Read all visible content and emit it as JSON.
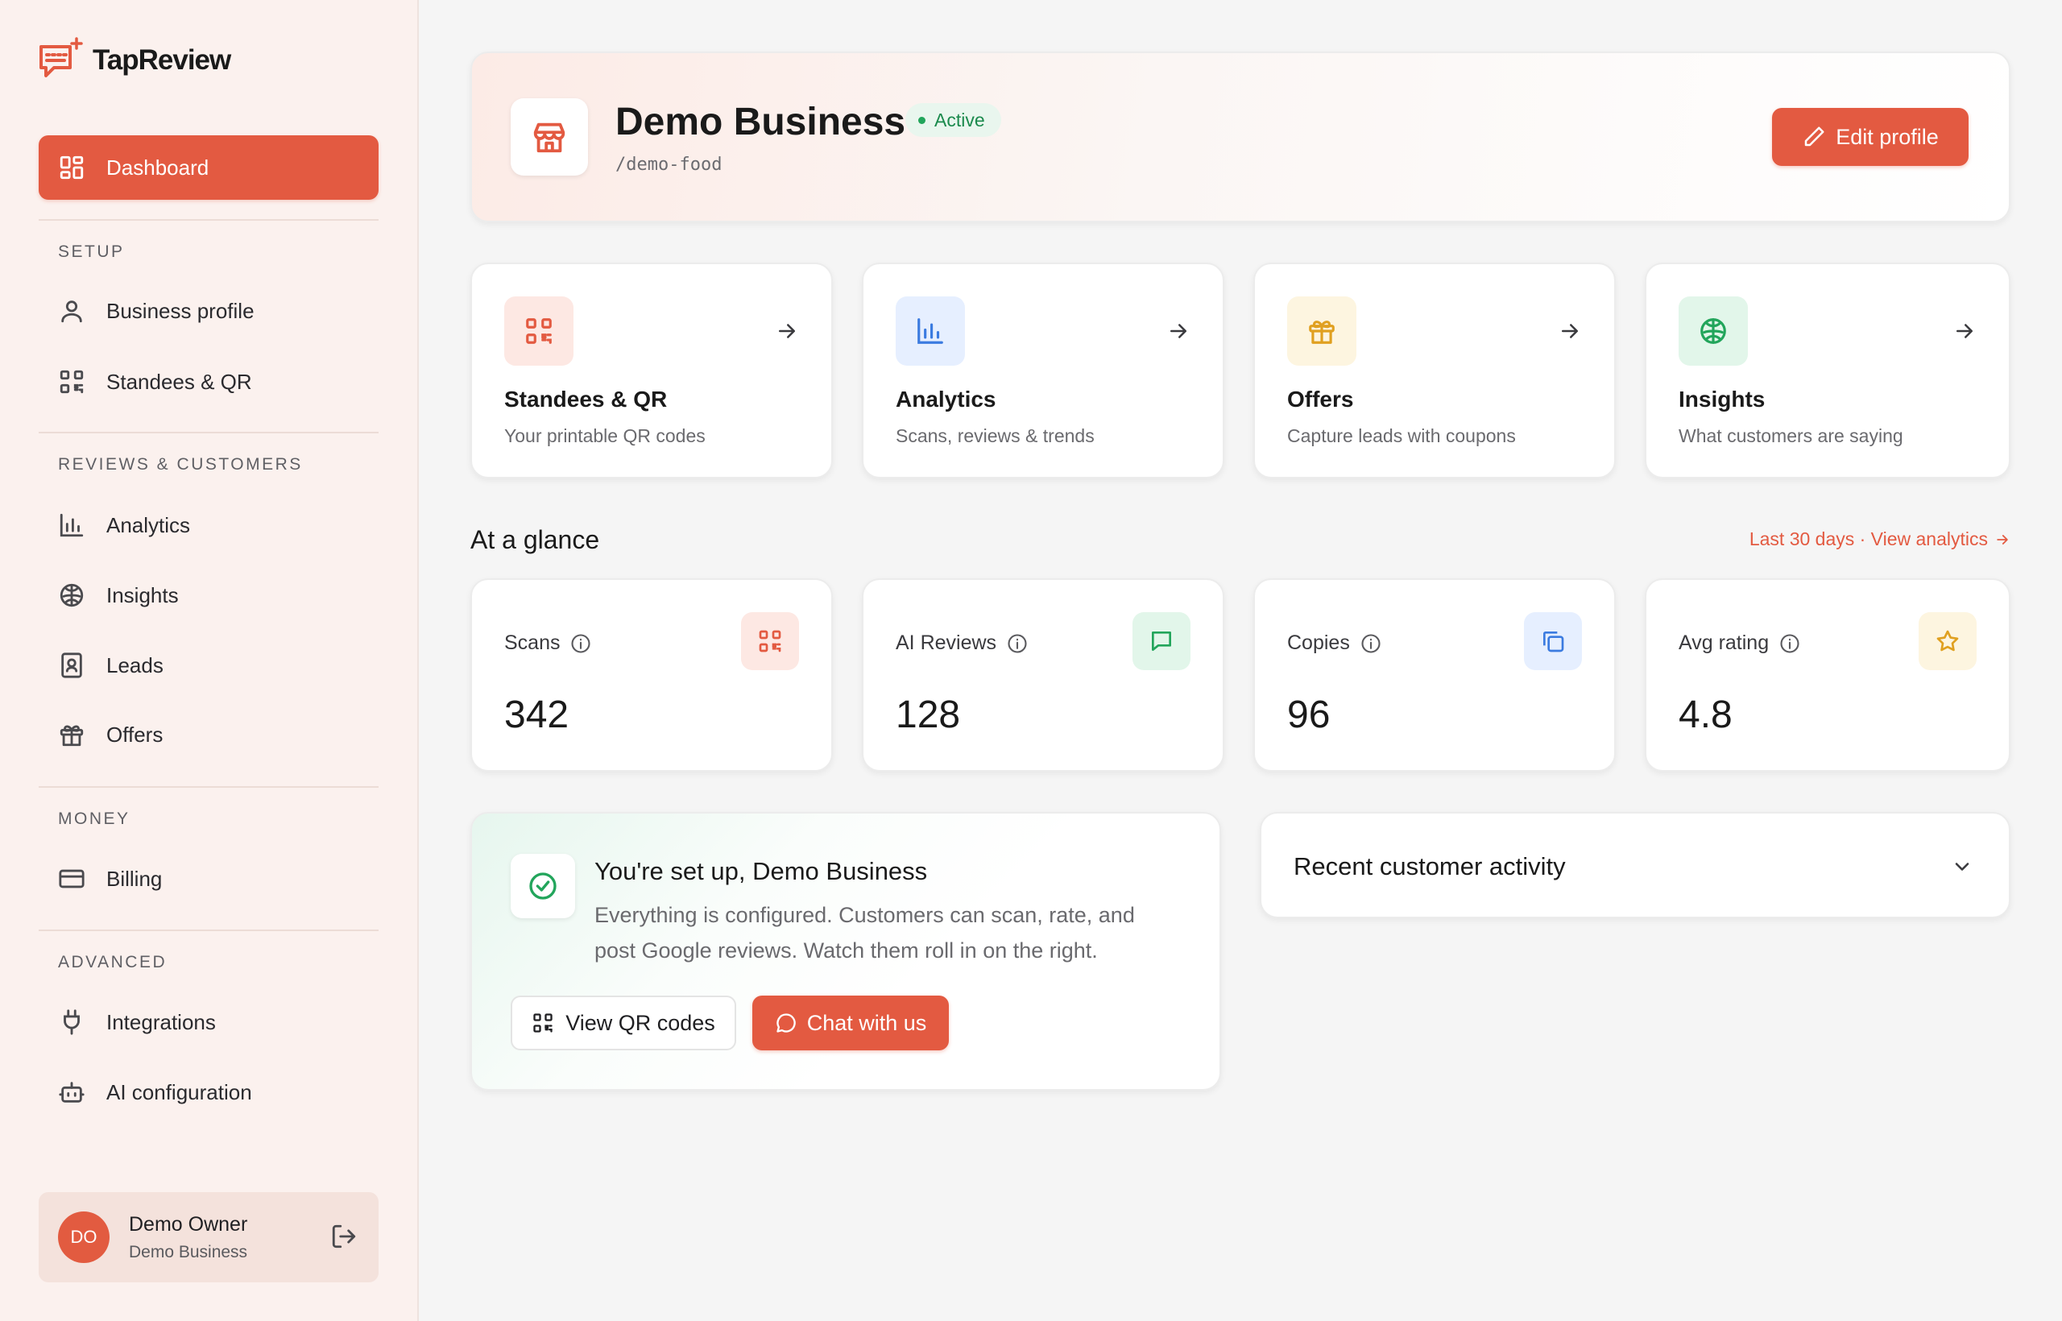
{
  "brand": {
    "name": "TapReview",
    "accent": "#e35a41"
  },
  "sidebar": {
    "dashboard": "Dashboard",
    "sections": {
      "setup": "SETUP",
      "reviews": "REVIEWS & CUSTOMERS",
      "money": "MONEY",
      "advanced": "ADVANCED"
    },
    "items": {
      "business_profile": "Business profile",
      "standees_qr": "Standees & QR",
      "analytics": "Analytics",
      "insights": "Insights",
      "leads": "Leads",
      "offers": "Offers",
      "billing": "Billing",
      "integrations": "Integrations",
      "ai_configuration": "AI configuration"
    },
    "user": {
      "initials": "DO",
      "name": "Demo Owner",
      "business": "Demo Business"
    }
  },
  "hero": {
    "title": "Demo Business",
    "status": "Active",
    "slug": "/demo-food",
    "edit_label": "Edit profile"
  },
  "features": [
    {
      "title": "Standees & QR",
      "subtitle": "Your printable QR codes",
      "icon": "qr-icon",
      "color": "#e35a41"
    },
    {
      "title": "Analytics",
      "subtitle": "Scans, reviews & trends",
      "icon": "bar-chart-icon",
      "color": "#3b7be0"
    },
    {
      "title": "Offers",
      "subtitle": "Capture leads with coupons",
      "icon": "gift-icon",
      "color": "#e0a020"
    },
    {
      "title": "Insights",
      "subtitle": "What customers are saying",
      "icon": "brain-icon",
      "color": "#22a55b"
    }
  ],
  "glance": {
    "title": "At a glance",
    "link": "Last 30 days · View analytics",
    "stats": [
      {
        "label": "Scans",
        "value": "342",
        "icon": "qr-icon"
      },
      {
        "label": "AI Reviews",
        "value": "128",
        "icon": "message-icon"
      },
      {
        "label": "Copies",
        "value": "96",
        "icon": "copy-icon"
      },
      {
        "label": "Avg rating",
        "value": "4.8",
        "icon": "star-icon"
      }
    ]
  },
  "setup": {
    "title": "You're set up, Demo Business",
    "text": "Everything is configured. Customers can scan, rate, and post Google reviews. Watch them roll in on the right.",
    "view_qr": "View QR codes",
    "chat": "Chat with us"
  },
  "activity": {
    "title": "Recent customer activity"
  }
}
